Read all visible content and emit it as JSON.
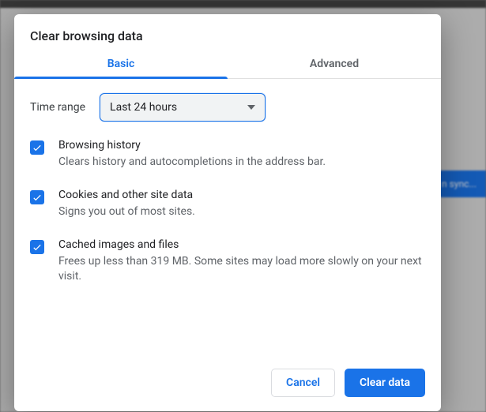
{
  "bg": {
    "sync_pill": "n sync..."
  },
  "dialog": {
    "title": "Clear browsing data",
    "tabs": {
      "basic": "Basic",
      "advanced": "Advanced"
    },
    "time_range": {
      "label": "Time range",
      "selected": "Last 24 hours"
    },
    "options": [
      {
        "title": "Browsing history",
        "desc": "Clears history and autocompletions in the address bar.",
        "checked": true
      },
      {
        "title": "Cookies and other site data",
        "desc": "Signs you out of most sites.",
        "checked": true
      },
      {
        "title": "Cached images and files",
        "desc": "Frees up less than 319 MB. Some sites may load more slowly on your next visit.",
        "checked": true
      }
    ],
    "buttons": {
      "cancel": "Cancel",
      "clear": "Clear data"
    }
  }
}
